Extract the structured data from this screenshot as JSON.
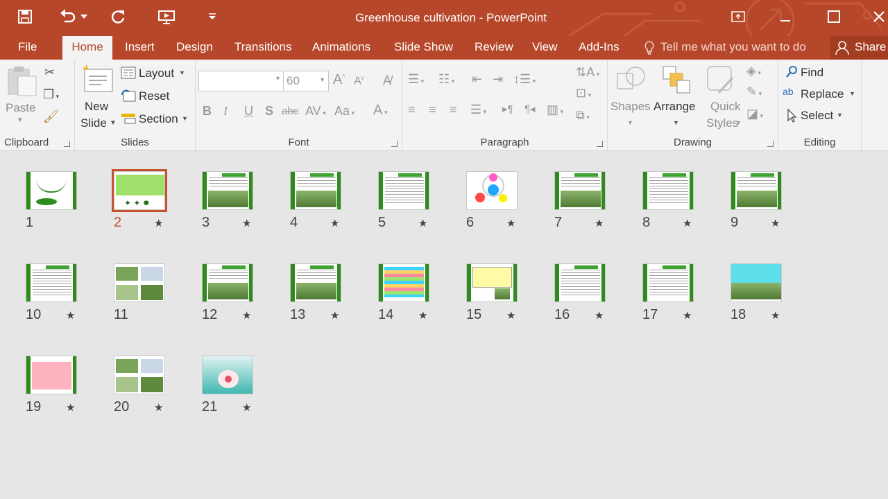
{
  "window": {
    "title": "Greenhouse cultivation - PowerPoint",
    "accent": "#b7472a"
  },
  "qat": [
    "save-icon",
    "undo-icon",
    "redo-icon",
    "present-icon",
    "customize-icon"
  ],
  "tabs": [
    {
      "label": "File"
    },
    {
      "label": "Home",
      "active": true
    },
    {
      "label": "Insert"
    },
    {
      "label": "Design"
    },
    {
      "label": "Transitions"
    },
    {
      "label": "Animations"
    },
    {
      "label": "Slide Show"
    },
    {
      "label": "Review"
    },
    {
      "label": "View"
    },
    {
      "label": "Add-Ins"
    }
  ],
  "tell_me": "Tell me what you want to do",
  "share": "Share",
  "ribbon": {
    "clipboard": {
      "label": "Clipboard",
      "paste": "Paste"
    },
    "slides": {
      "label": "Slides",
      "new_slide_1": "New",
      "new_slide_2": "Slide",
      "layout": "Layout",
      "reset": "Reset",
      "section": "Section"
    },
    "font": {
      "label": "Font",
      "font_size": "60",
      "font_name": ""
    },
    "paragraph": {
      "label": "Paragraph"
    },
    "drawing": {
      "label": "Drawing",
      "shapes": "Shapes",
      "arrange": "Arrange",
      "quick_1": "Quick",
      "quick_2": "Styles"
    },
    "editing": {
      "label": "Editing",
      "find": "Find",
      "replace": "Replace",
      "select": "Select"
    }
  },
  "slides": [
    {
      "num": "1",
      "star": false,
      "kind": "title"
    },
    {
      "num": "2",
      "star": true,
      "kind": "leaves",
      "selected": true
    },
    {
      "num": "3",
      "star": true,
      "kind": "textpic"
    },
    {
      "num": "4",
      "star": true,
      "kind": "textpic"
    },
    {
      "num": "5",
      "star": true,
      "kind": "text"
    },
    {
      "num": "6",
      "star": true,
      "kind": "circles"
    },
    {
      "num": "7",
      "star": true,
      "kind": "textpic"
    },
    {
      "num": "8",
      "star": true,
      "kind": "text"
    },
    {
      "num": "9",
      "star": true,
      "kind": "textpic"
    },
    {
      "num": "10",
      "star": true,
      "kind": "text"
    },
    {
      "num": "11",
      "star": false,
      "kind": "photos"
    },
    {
      "num": "12",
      "star": true,
      "kind": "textpic"
    },
    {
      "num": "13",
      "star": true,
      "kind": "textpic"
    },
    {
      "num": "14",
      "star": true,
      "kind": "bands"
    },
    {
      "num": "15",
      "star": true,
      "kind": "yellow"
    },
    {
      "num": "16",
      "star": true,
      "kind": "text"
    },
    {
      "num": "17",
      "star": true,
      "kind": "text"
    },
    {
      "num": "18",
      "star": true,
      "kind": "cyan"
    },
    {
      "num": "19",
      "star": true,
      "kind": "pink"
    },
    {
      "num": "20",
      "star": true,
      "kind": "photos"
    },
    {
      "num": "21",
      "star": true,
      "kind": "ending"
    }
  ]
}
